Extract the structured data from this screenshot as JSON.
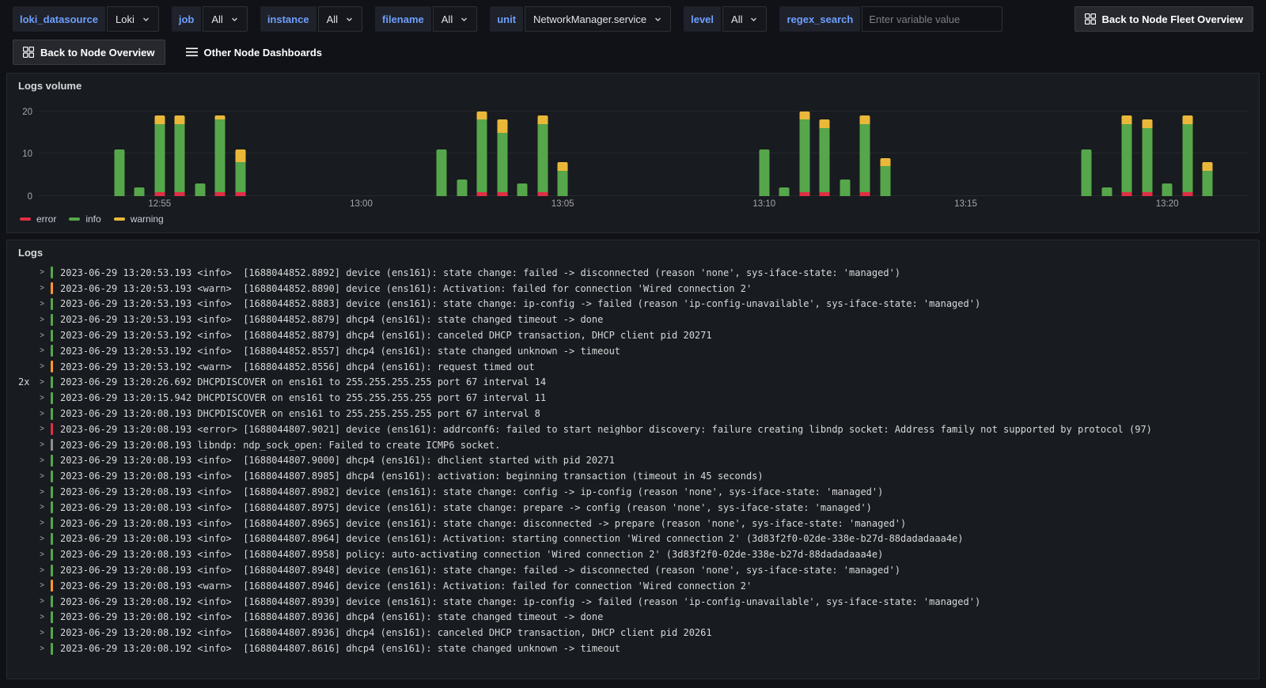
{
  "toolbar": {
    "variables": [
      {
        "label": "loki_datasource",
        "value": "Loki"
      },
      {
        "label": "job",
        "value": "All"
      },
      {
        "label": "instance",
        "value": "All"
      },
      {
        "label": "filename",
        "value": "All"
      },
      {
        "label": "unit",
        "value": "NetworkManager.service"
      },
      {
        "label": "level",
        "value": "All"
      }
    ],
    "regex_label": "regex_search",
    "regex_value": "",
    "regex_placeholder": "Enter variable value",
    "fleet_button": "Back to Node Fleet Overview",
    "node_button": "Back to Node Overview",
    "other_dashboards": "Other Node Dashboards"
  },
  "icons": {
    "fleet_button_icon": "apps-grid-icon",
    "node_button_icon": "apps-grid-icon",
    "other_dashboards_icon": "list-menu-icon",
    "variable_dropdown_icon": "chevron-down-icon",
    "log_row_icon": "expand-chevron-icon"
  },
  "logs_volume_panel": {
    "title": "Logs volume",
    "legend": [
      {
        "label": "error",
        "color": "#e02f44"
      },
      {
        "label": "info",
        "color": "#56a64b"
      },
      {
        "label": "warning",
        "color": "#eab839"
      }
    ]
  },
  "chart_data": {
    "type": "bar",
    "stacked": true,
    "title": "Logs volume",
    "legend_position": "bottom",
    "grid": true,
    "x_axis": {
      "xlim": [
        0,
        30
      ],
      "unit": "minutes-after-12:52",
      "ticks": [
        {
          "pos": 3,
          "label": "12:55"
        },
        {
          "pos": 8,
          "label": "13:00"
        },
        {
          "pos": 13,
          "label": "13:05"
        },
        {
          "pos": 18,
          "label": "13:10"
        },
        {
          "pos": 23,
          "label": "13:15"
        },
        {
          "pos": 28,
          "label": "13:20"
        }
      ]
    },
    "y_axis": {
      "ylim": [
        0,
        22
      ],
      "ticks": [
        0,
        10,
        20
      ]
    },
    "series_order": [
      "error",
      "info",
      "warning"
    ],
    "colors": {
      "error": "#e02f44",
      "info": "#56a64b",
      "warning": "#eab839"
    },
    "bars": [
      {
        "x": 2.0,
        "time": "12:54:00",
        "error": 0,
        "info": 11,
        "warning": 0
      },
      {
        "x": 2.5,
        "time": "12:54:30",
        "error": 0,
        "info": 2,
        "warning": 0
      },
      {
        "x": 3.0,
        "time": "12:55:00",
        "error": 1,
        "info": 16,
        "warning": 2
      },
      {
        "x": 3.5,
        "time": "12:55:30",
        "error": 1,
        "info": 16,
        "warning": 2
      },
      {
        "x": 4.0,
        "time": "12:56:00",
        "error": 0,
        "info": 3,
        "warning": 0
      },
      {
        "x": 4.5,
        "time": "12:56:30",
        "error": 1,
        "info": 17,
        "warning": 1
      },
      {
        "x": 5.0,
        "time": "12:57:00",
        "error": 1,
        "info": 7,
        "warning": 3
      },
      {
        "x": 10.0,
        "time": "13:02:00",
        "error": 0,
        "info": 11,
        "warning": 0
      },
      {
        "x": 10.5,
        "time": "13:02:30",
        "error": 0,
        "info": 4,
        "warning": 0
      },
      {
        "x": 11.0,
        "time": "13:03:00",
        "error": 1,
        "info": 17,
        "warning": 2
      },
      {
        "x": 11.5,
        "time": "13:03:30",
        "error": 1,
        "info": 14,
        "warning": 3
      },
      {
        "x": 12.0,
        "time": "13:04:00",
        "error": 0,
        "info": 3,
        "warning": 0
      },
      {
        "x": 12.5,
        "time": "13:04:30",
        "error": 1,
        "info": 16,
        "warning": 2
      },
      {
        "x": 13.0,
        "time": "13:05:00",
        "error": 0,
        "info": 6,
        "warning": 2
      },
      {
        "x": 18.0,
        "time": "13:10:00",
        "error": 0,
        "info": 11,
        "warning": 0
      },
      {
        "x": 18.5,
        "time": "13:10:30",
        "error": 0,
        "info": 2,
        "warning": 0
      },
      {
        "x": 19.0,
        "time": "13:11:00",
        "error": 1,
        "info": 17,
        "warning": 2
      },
      {
        "x": 19.5,
        "time": "13:11:30",
        "error": 1,
        "info": 15,
        "warning": 2
      },
      {
        "x": 20.0,
        "time": "13:12:00",
        "error": 0,
        "info": 4,
        "warning": 0
      },
      {
        "x": 20.5,
        "time": "13:12:30",
        "error": 1,
        "info": 16,
        "warning": 2
      },
      {
        "x": 21.0,
        "time": "13:13:00",
        "error": 0,
        "info": 7,
        "warning": 2
      },
      {
        "x": 26.0,
        "time": "13:18:00",
        "error": 0,
        "info": 11,
        "warning": 0
      },
      {
        "x": 26.5,
        "time": "13:18:30",
        "error": 0,
        "info": 2,
        "warning": 0
      },
      {
        "x": 27.0,
        "time": "13:19:00",
        "error": 1,
        "info": 16,
        "warning": 2
      },
      {
        "x": 27.5,
        "time": "13:19:30",
        "error": 1,
        "info": 15,
        "warning": 2
      },
      {
        "x": 28.0,
        "time": "13:20:00",
        "error": 0,
        "info": 3,
        "warning": 0
      },
      {
        "x": 28.5,
        "time": "13:20:30",
        "error": 1,
        "info": 16,
        "warning": 2
      },
      {
        "x": 29.0,
        "time": "13:21:00",
        "error": 0,
        "info": 6,
        "warning": 2
      }
    ]
  },
  "logs_panel": {
    "title": "Logs",
    "level_colors": {
      "info": "#56a64b",
      "warn": "#ff9830",
      "error": "#e02f44",
      "unknown": "#8e8e8e"
    },
    "rows": [
      {
        "dup": "",
        "level": "info",
        "text": "2023-06-29 13:20:53.193 <info>  [1688044852.8892] device (ens161): state change: failed -> disconnected (reason 'none', sys-iface-state: 'managed')"
      },
      {
        "dup": "",
        "level": "warn",
        "text": "2023-06-29 13:20:53.193 <warn>  [1688044852.8890] device (ens161): Activation: failed for connection 'Wired connection 2'"
      },
      {
        "dup": "",
        "level": "info",
        "text": "2023-06-29 13:20:53.193 <info>  [1688044852.8883] device (ens161): state change: ip-config -> failed (reason 'ip-config-unavailable', sys-iface-state: 'managed')"
      },
      {
        "dup": "",
        "level": "info",
        "text": "2023-06-29 13:20:53.193 <info>  [1688044852.8879] dhcp4 (ens161): state changed timeout -> done"
      },
      {
        "dup": "",
        "level": "info",
        "text": "2023-06-29 13:20:53.192 <info>  [1688044852.8879] dhcp4 (ens161): canceled DHCP transaction, DHCP client pid 20271"
      },
      {
        "dup": "",
        "level": "info",
        "text": "2023-06-29 13:20:53.192 <info>  [1688044852.8557] dhcp4 (ens161): state changed unknown -> timeout"
      },
      {
        "dup": "",
        "level": "warn",
        "text": "2023-06-29 13:20:53.192 <warn>  [1688044852.8556] dhcp4 (ens161): request timed out"
      },
      {
        "dup": "2x",
        "level": "info",
        "text": "2023-06-29 13:20:26.692 DHCPDISCOVER on ens161 to 255.255.255.255 port 67 interval 14"
      },
      {
        "dup": "",
        "level": "info",
        "text": "2023-06-29 13:20:15.942 DHCPDISCOVER on ens161 to 255.255.255.255 port 67 interval 11"
      },
      {
        "dup": "",
        "level": "info",
        "text": "2023-06-29 13:20:08.193 DHCPDISCOVER on ens161 to 255.255.255.255 port 67 interval 8"
      },
      {
        "dup": "",
        "level": "error",
        "text": "2023-06-29 13:20:08.193 <error> [1688044807.9021] device (ens161): addrconf6: failed to start neighbor discovery: failure creating libndp socket: Address family not supported by protocol (97)"
      },
      {
        "dup": "",
        "level": "unknown",
        "text": "2023-06-29 13:20:08.193 libndp: ndp_sock_open: Failed to create ICMP6 socket."
      },
      {
        "dup": "",
        "level": "info",
        "text": "2023-06-29 13:20:08.193 <info>  [1688044807.9000] dhcp4 (ens161): dhclient started with pid 20271"
      },
      {
        "dup": "",
        "level": "info",
        "text": "2023-06-29 13:20:08.193 <info>  [1688044807.8985] dhcp4 (ens161): activation: beginning transaction (timeout in 45 seconds)"
      },
      {
        "dup": "",
        "level": "info",
        "text": "2023-06-29 13:20:08.193 <info>  [1688044807.8982] device (ens161): state change: config -> ip-config (reason 'none', sys-iface-state: 'managed')"
      },
      {
        "dup": "",
        "level": "info",
        "text": "2023-06-29 13:20:08.193 <info>  [1688044807.8975] device (ens161): state change: prepare -> config (reason 'none', sys-iface-state: 'managed')"
      },
      {
        "dup": "",
        "level": "info",
        "text": "2023-06-29 13:20:08.193 <info>  [1688044807.8965] device (ens161): state change: disconnected -> prepare (reason 'none', sys-iface-state: 'managed')"
      },
      {
        "dup": "",
        "level": "info",
        "text": "2023-06-29 13:20:08.193 <info>  [1688044807.8964] device (ens161): Activation: starting connection 'Wired connection 2' (3d83f2f0-02de-338e-b27d-88dadadaaa4e)"
      },
      {
        "dup": "",
        "level": "info",
        "text": "2023-06-29 13:20:08.193 <info>  [1688044807.8958] policy: auto-activating connection 'Wired connection 2' (3d83f2f0-02de-338e-b27d-88dadadaaa4e)"
      },
      {
        "dup": "",
        "level": "info",
        "text": "2023-06-29 13:20:08.193 <info>  [1688044807.8948] device (ens161): state change: failed -> disconnected (reason 'none', sys-iface-state: 'managed')"
      },
      {
        "dup": "",
        "level": "warn",
        "text": "2023-06-29 13:20:08.193 <warn>  [1688044807.8946] device (ens161): Activation: failed for connection 'Wired connection 2'"
      },
      {
        "dup": "",
        "level": "info",
        "text": "2023-06-29 13:20:08.192 <info>  [1688044807.8939] device (ens161): state change: ip-config -> failed (reason 'ip-config-unavailable', sys-iface-state: 'managed')"
      },
      {
        "dup": "",
        "level": "info",
        "text": "2023-06-29 13:20:08.192 <info>  [1688044807.8936] dhcp4 (ens161): state changed timeout -> done"
      },
      {
        "dup": "",
        "level": "info",
        "text": "2023-06-29 13:20:08.192 <info>  [1688044807.8936] dhcp4 (ens161): canceled DHCP transaction, DHCP client pid 20261"
      },
      {
        "dup": "",
        "level": "info",
        "text": "2023-06-29 13:20:08.192 <info>  [1688044807.8616] dhcp4 (ens161): state changed unknown -> timeout"
      }
    ]
  }
}
